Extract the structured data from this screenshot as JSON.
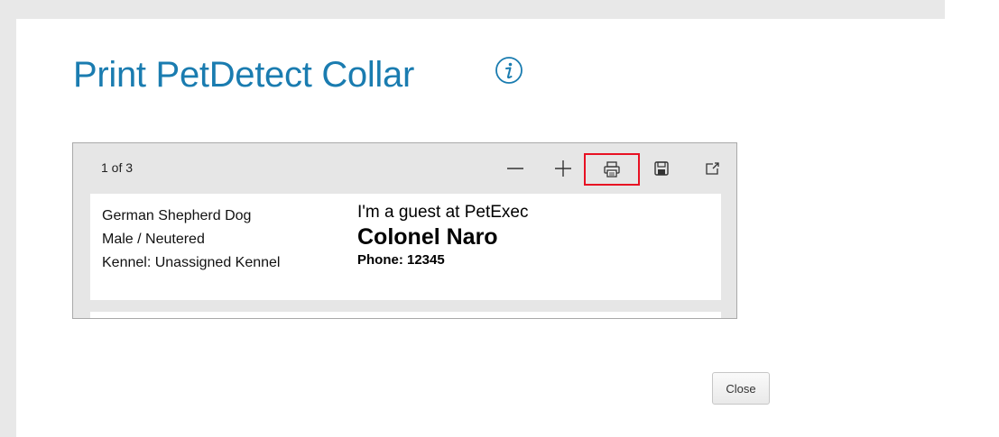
{
  "dialog": {
    "title": "Print PetDetect Collar",
    "close_label": "Close"
  },
  "icons": {
    "info": "info-icon",
    "zoom_out": "minus-icon",
    "zoom_in": "plus-icon",
    "print": "printer-icon",
    "save": "floppy-disk-icon",
    "popout": "open-in-new-window-icon"
  },
  "viewer": {
    "page_count": "1 of 3"
  },
  "collar": {
    "breed": "German Shepherd Dog",
    "sex": "Male / Neutered",
    "kennel": "Kennel: Unassigned Kennel",
    "guest_line": "I'm a guest at PetExec",
    "pet_name": "Colonel Naro",
    "phone": "Phone: 12345"
  },
  "colors": {
    "title": "#1a7cb0",
    "highlight": "#e81123",
    "frame": "#e8e8e8"
  }
}
